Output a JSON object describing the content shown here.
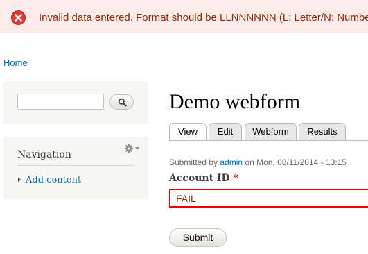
{
  "messages": {
    "error_text": "Invalid data entered. Format should be LLNNNNNN (L: Letter/N: Number)",
    "icon": "error-circle-x-icon",
    "color_text": "#8c2e0b",
    "color_bg": "#fcece9"
  },
  "breadcrumb": {
    "home": "Home"
  },
  "search": {
    "placeholder": "",
    "button_icon": "magnifier-icon"
  },
  "navigation": {
    "title": "Navigation",
    "gear_icon": "gear-icon",
    "items": [
      {
        "label": "Add content"
      }
    ]
  },
  "main": {
    "title": "Demo webform",
    "tabs": [
      {
        "label": "View",
        "active": true
      },
      {
        "label": "Edit",
        "active": false
      },
      {
        "label": "Webform",
        "active": false
      },
      {
        "label": "Results",
        "active": false
      }
    ],
    "submitted_prefix": "Submitted by ",
    "submitted_user": "admin",
    "submitted_suffix": " on Mon, 08/11/2014 - 13:15",
    "field": {
      "label": "Account ID",
      "required_mark": "*",
      "value": "FAIL"
    },
    "submit_label": "Submit"
  },
  "colors": {
    "link": "#0071b3",
    "error_border": "#ee0000"
  }
}
